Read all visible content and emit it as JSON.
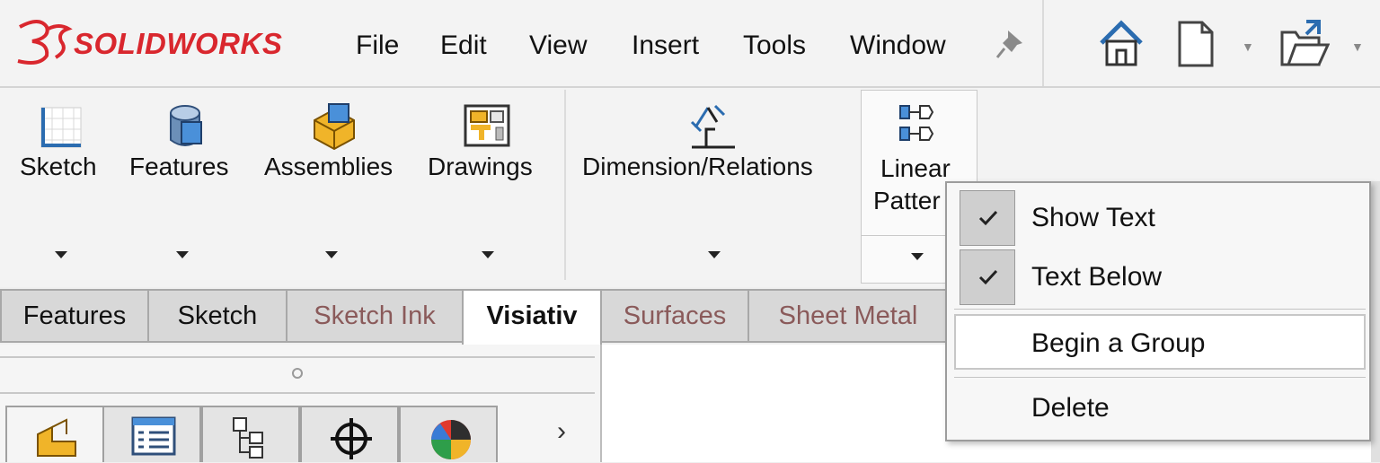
{
  "app": {
    "brand_prefix": "3DS",
    "brand_text": "SOLIDWORKS",
    "brand_color": "#d9272e"
  },
  "menu": {
    "items": [
      "File",
      "Edit",
      "View",
      "Insert",
      "Tools",
      "Window"
    ],
    "pin_icon": "pin-icon"
  },
  "quick_access": {
    "icons": [
      "home-icon",
      "new-document-icon",
      "open-folder-icon"
    ]
  },
  "command_manager": {
    "buttons": [
      {
        "label": "Sketch",
        "icon": "sketch-icon"
      },
      {
        "label": "Features",
        "icon": "features-icon"
      },
      {
        "label": "Assemblies",
        "icon": "assemblies-icon"
      },
      {
        "label": "Drawings",
        "icon": "drawings-icon"
      },
      {
        "label": "Dimension/Relations",
        "icon": "dimension-relations-icon"
      },
      {
        "label_line1": "Linear",
        "label_line2": "Patter",
        "icon": "linear-pattern-icon"
      }
    ]
  },
  "tabs": [
    {
      "label": "Features",
      "state": "normal"
    },
    {
      "label": "Sketch",
      "state": "normal"
    },
    {
      "label": "Sketch Ink",
      "state": "dim"
    },
    {
      "label": "Visiativ",
      "state": "active"
    },
    {
      "label": "Surfaces",
      "state": "dim"
    },
    {
      "label": "Sheet Metal",
      "state": "dim"
    }
  ],
  "feature_manager": {
    "tab_icons": [
      "part-icon",
      "property-manager-icon",
      "configuration-manager-icon",
      "dimxpert-icon",
      "display-manager-icon"
    ],
    "more": "›"
  },
  "context_menu": {
    "items": [
      {
        "label": "Show Text",
        "checked": true
      },
      {
        "label": "Text Below",
        "checked": true
      },
      {
        "label": "Begin a Group",
        "checked": false
      },
      {
        "label": "Delete",
        "checked": false
      }
    ]
  }
}
